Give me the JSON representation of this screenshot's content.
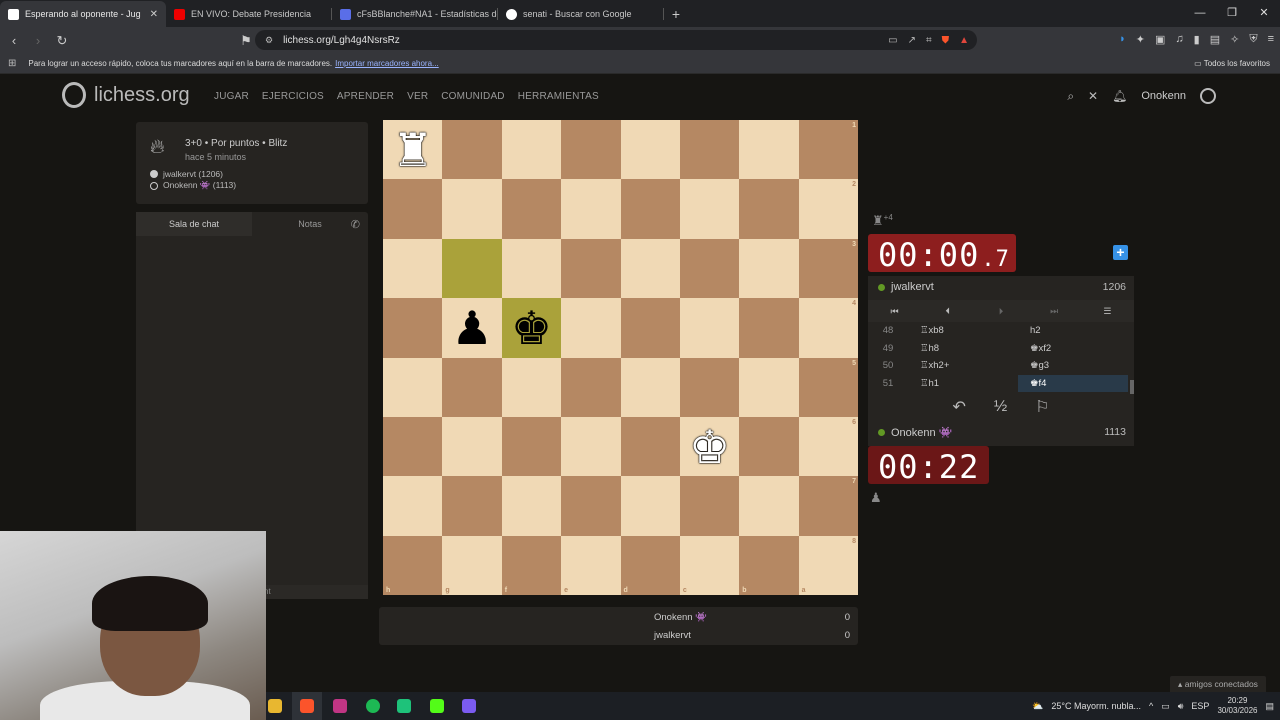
{
  "browser": {
    "tabs": [
      {
        "title": "Esperando al oponente - Jug",
        "color": "#ffffff",
        "active": true
      },
      {
        "title": "EN VIVO: Debate Presidencia",
        "color": "#ff0000",
        "active": false
      },
      {
        "title": "cFsBBlanche#NA1 - Estadísticas del",
        "color": "#5a6ee8",
        "active": false
      },
      {
        "title": "senati - Buscar con Google",
        "color": "#ffffff",
        "active": false
      }
    ],
    "url": "lichess.org/Lgh4g4NsrsRz",
    "bookmarks_text": "Para lograr un acceso rápido, coloca tus marcadores aquí en la barra de marcadores.",
    "bookmarks_link": "Importar marcadores ahora...",
    "all_favorites": "Todos los favoritos"
  },
  "site": {
    "logo_text": "lichess.org",
    "menu": [
      "JUGAR",
      "EJERCICIOS",
      "APRENDER",
      "VER",
      "COMUNIDAD",
      "HERRAMIENTAS"
    ],
    "username": "Onokenn"
  },
  "game_info": {
    "mode": "3+0 • Por puntos • Blitz",
    "time_ago": "hace 5 minutos",
    "white_player": "jwalkervt (1206)",
    "black_player": "Onokenn 👾 (1113)"
  },
  "chat": {
    "tab_chat": "Sala de chat",
    "tab_notes": "Notas",
    "input_hint": "nt"
  },
  "board": {
    "ranks": [
      "1",
      "2",
      "3",
      "4",
      "5",
      "6",
      "7",
      "8"
    ],
    "files": [
      "h",
      "g",
      "f",
      "e",
      "d",
      "c",
      "b",
      "a"
    ],
    "pieces": {
      "0-0": {
        "glyph": "♜",
        "color": "w"
      },
      "3-1": {
        "glyph": "♟",
        "color": "b"
      },
      "3-2": {
        "glyph": "♚",
        "color": "b"
      },
      "5-5": {
        "glyph": "♚",
        "color": "w"
      }
    },
    "highlights": [
      "2-1",
      "3-2"
    ]
  },
  "scores": [
    {
      "name": "Onokenn 👾",
      "score": "0"
    },
    {
      "name": "jwalkervt",
      "score": "0"
    }
  ],
  "top_player": {
    "captured": "♜",
    "advantage": "+4",
    "clock_main": "00:00",
    "clock_tenth": ".7",
    "name": "jwalkervt",
    "rating": "1206"
  },
  "bottom_player": {
    "captured": "♟",
    "clock": "00:22",
    "name": "Onokenn 👾",
    "rating": "1113"
  },
  "moves": [
    {
      "num": "48",
      "white": "♖xb8",
      "black": "h2"
    },
    {
      "num": "49",
      "white": "♖h8",
      "black": "♚xf2"
    },
    {
      "num": "50",
      "white": "♖xh2+",
      "black": "♚g3"
    },
    {
      "num": "51",
      "white": "♖h1",
      "black": "♚f4"
    }
  ],
  "move_nav": [
    "⏮",
    "⏴",
    "⏵",
    "⏭",
    "☰"
  ],
  "actions": {
    "takeback": "↶",
    "draw": "½",
    "resign": "⚐"
  },
  "friends": "amigos conectados",
  "taskbar": {
    "weather": "25°C  Mayorm. nubla...",
    "lang": "ESP",
    "time": "20:29",
    "date": "30/03/2026"
  }
}
